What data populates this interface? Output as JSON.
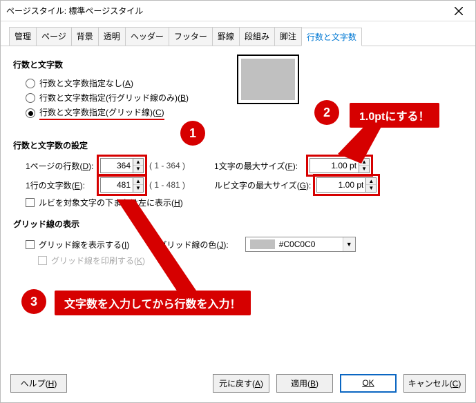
{
  "title": "ページスタイル: 標準ページスタイル",
  "tabs": [
    "管理",
    "ページ",
    "背景",
    "透明",
    "ヘッダー",
    "フッター",
    "罫線",
    "段組み",
    "脚注",
    "行数と文字数"
  ],
  "activeTab": 9,
  "section1_title": "行数と文字数",
  "radios": {
    "none": {
      "label": "行数と文字数指定なし",
      "accel": "A"
    },
    "grid_lines": {
      "label": "行数と文字数指定(行グリッド線のみ)",
      "accel": "B"
    },
    "grid_full": {
      "label": "行数と文字数指定(グリッド線)",
      "accel": "C"
    }
  },
  "section2_title": "行数と文字数の設定",
  "lines_per_page": {
    "label": "1ページの行数",
    "accel": "D",
    "value": "364",
    "range": "( 1 - 364 )"
  },
  "chars_per_line": {
    "label": "1行の文字数",
    "accel": "E",
    "value": "481",
    "range": "( 1 - 481 )"
  },
  "max_char_size": {
    "label": "1文字の最大サイズ",
    "accel": "F",
    "value": "1.00 pt"
  },
  "max_ruby_size": {
    "label": "ルビ文字の最大サイズ",
    "accel": "G",
    "value": "1.00 pt"
  },
  "ruby_below": {
    "label": "ルビを対象文字の下または左に表示",
    "accel": "H"
  },
  "section3_title": "グリッド線の表示",
  "show_grid": {
    "label": "グリッド線を表示する",
    "accel": "I"
  },
  "grid_color_label": {
    "label": "グリッド線の色",
    "accel": "J"
  },
  "grid_color": {
    "value": "#C0C0C0",
    "swatch": "#c0c0c0"
  },
  "print_grid": {
    "label": "グリッド線を印刷する",
    "accel": "K"
  },
  "buttons": {
    "help": "ヘルプ",
    "helpA": "H",
    "reset": "元に戻す",
    "resetA": "A",
    "apply": "適用",
    "applyA": "B",
    "ok": "OK",
    "cancel": "キャンセル",
    "cancelA": "C"
  },
  "annotations": {
    "callout1": "1.0ptにする！",
    "callout2": "文字数を入力してから行数を入力！"
  }
}
